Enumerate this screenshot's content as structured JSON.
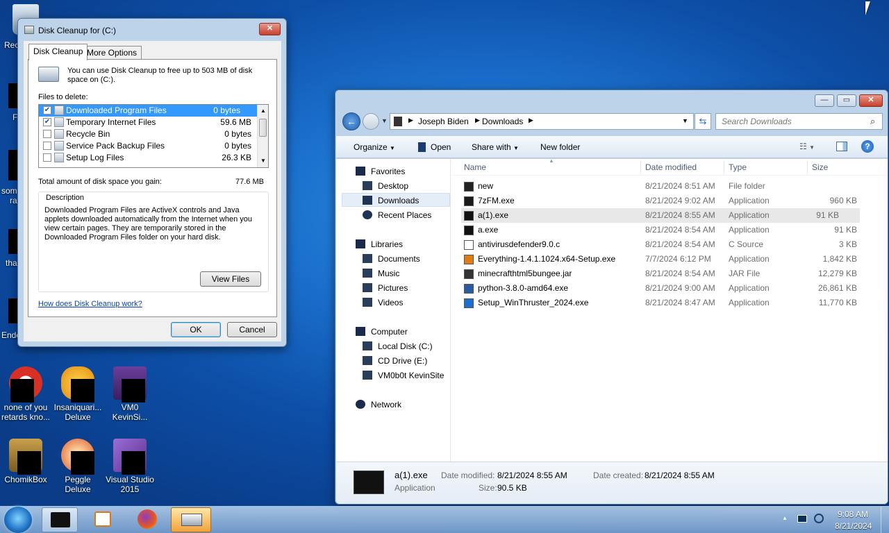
{
  "desktop": {
    "icons": [
      {
        "label_line1": "none of you",
        "label_line2": "retards kno..."
      },
      {
        "label_line1": "Insaniquari...",
        "label_line2": "Deluxe"
      },
      {
        "label_line1": "VM0",
        "label_line2": "KevinSi..."
      },
      {
        "label_line1": "ChomikBox",
        "label_line2": ""
      },
      {
        "label_line1": "Peggle",
        "label_line2": "Deluxe"
      },
      {
        "label_line1": "Visual Studio",
        "label_line2": "2015"
      }
    ],
    "left_peek": [
      "Rec",
      "F",
      "som",
      "ra",
      "tha",
      "Ende"
    ]
  },
  "cleanup": {
    "title": "Disk Cleanup for  (C:)",
    "tabs": [
      "Disk Cleanup",
      "More Options"
    ],
    "intro": "You can use Disk Cleanup to free up to 503 MB of disk space on  (C:).",
    "files_label": "Files to delete:",
    "files": [
      {
        "name": "Downloaded Program Files",
        "size": "0 bytes",
        "checked": true
      },
      {
        "name": "Temporary Internet Files",
        "size": "59.6 MB",
        "checked": true
      },
      {
        "name": "Recycle Bin",
        "size": "0 bytes",
        "checked": false
      },
      {
        "name": "Service Pack Backup Files",
        "size": "0 bytes",
        "checked": false
      },
      {
        "name": "Setup Log Files",
        "size": "26.3 KB",
        "checked": false
      }
    ],
    "total_label": "Total amount of disk space you gain:",
    "total_value": "77.6 MB",
    "description_label": "Description",
    "description": "Downloaded Program Files are ActiveX controls and Java applets downloaded automatically from the Internet when you view certain pages. They are temporarily stored in the Downloaded Program Files folder on your hard disk.",
    "view_files": "View Files",
    "help_link": "How does Disk Cleanup work?",
    "ok": "OK",
    "cancel": "Cancel",
    "close_glyph": "✕"
  },
  "explorer": {
    "breadcrumb": [
      "Joseph Biden",
      "Downloads"
    ],
    "search_placeholder": "Search Downloads",
    "toolbar": {
      "organize": "Organize",
      "open": "Open",
      "share": "Share with",
      "new_folder": "New folder"
    },
    "nav": {
      "favorites": "Favorites",
      "favorites_items": [
        "Desktop",
        "Downloads",
        "Recent Places"
      ],
      "libraries": "Libraries",
      "libraries_items": [
        "Documents",
        "Music",
        "Pictures",
        "Videos"
      ],
      "computer": "Computer",
      "computer_items": [
        "Local Disk (C:)",
        "CD Drive (E:)",
        "VM0b0t KevinSite"
      ],
      "network": "Network"
    },
    "columns": [
      "Name",
      "Date modified",
      "Type",
      "Size"
    ],
    "files": [
      {
        "name": "new",
        "date": "8/21/2024 8:51 AM",
        "type": "File folder",
        "size": ""
      },
      {
        "name": "7zFM.exe",
        "date": "8/21/2024 9:02 AM",
        "type": "Application",
        "size": "960 KB"
      },
      {
        "name": "a(1).exe",
        "date": "8/21/2024 8:55 AM",
        "type": "Application",
        "size": "91 KB"
      },
      {
        "name": "a.exe",
        "date": "8/21/2024 8:54 AM",
        "type": "Application",
        "size": "91 KB"
      },
      {
        "name": "antivirusdefender9.0.c",
        "date": "8/21/2024 8:54 AM",
        "type": "C Source",
        "size": "3 KB"
      },
      {
        "name": "Everything-1.4.1.1024.x64-Setup.exe",
        "date": "7/7/2024 6:12 PM",
        "type": "Application",
        "size": "1,842 KB"
      },
      {
        "name": "minecrafthtml5bungee.jar",
        "date": "8/21/2024 8:54 AM",
        "type": "JAR File",
        "size": "12,279 KB"
      },
      {
        "name": "python-3.8.0-amd64.exe",
        "date": "8/21/2024 9:00 AM",
        "type": "Application",
        "size": "26,861 KB"
      },
      {
        "name": "Setup_WinThruster_2024.exe",
        "date": "8/21/2024 8:47 AM",
        "type": "Application",
        "size": "11,770 KB"
      }
    ],
    "details": {
      "name": "a(1).exe",
      "kind": "Application",
      "modified_label": "Date modified:",
      "modified": "8/21/2024 8:55 AM",
      "created_label": "Date created:",
      "created": "8/21/2024 8:55 AM",
      "size_label": "Size:",
      "size": "90.5 KB"
    },
    "caption_min": "—",
    "caption_max": "▭",
    "caption_close": "✕"
  },
  "taskbar": {
    "time": "9:08 AM",
    "date": "8/21/2024"
  }
}
